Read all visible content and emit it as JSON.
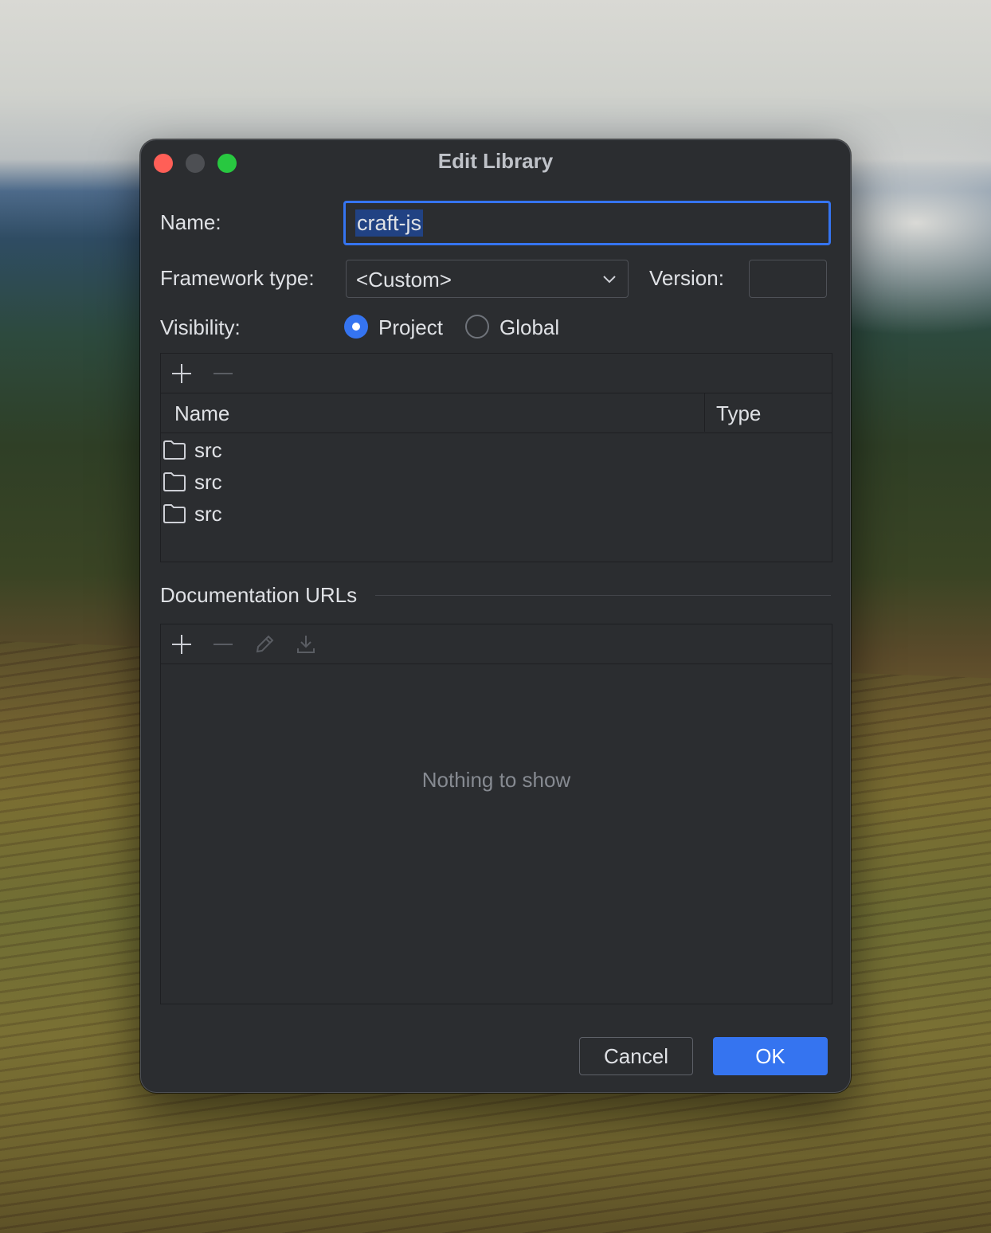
{
  "dialog": {
    "title": "Edit Library",
    "name_label": "Name:",
    "name_value": "craft-js",
    "framework_label": "Framework type:",
    "framework_value": "<Custom>",
    "version_label": "Version:",
    "version_value": "",
    "visibility_label": "Visibility:",
    "visibility_options": [
      {
        "label": "Project",
        "selected": true
      },
      {
        "label": "Global",
        "selected": false
      }
    ]
  },
  "roots_table": {
    "columns": [
      "Name",
      "Type"
    ],
    "rows": [
      {
        "name": "src",
        "icon": "folder-icon"
      },
      {
        "name": "src",
        "icon": "folder-icon"
      },
      {
        "name": "src",
        "icon": "folder-icon"
      }
    ]
  },
  "docs": {
    "title": "Documentation URLs",
    "empty_text": "Nothing to show"
  },
  "buttons": {
    "cancel": "Cancel",
    "ok": "OK"
  },
  "colors": {
    "accent": "#3574f0",
    "dialog_bg": "#2b2d30",
    "close": "#ff5f57",
    "maximize": "#28c840"
  }
}
